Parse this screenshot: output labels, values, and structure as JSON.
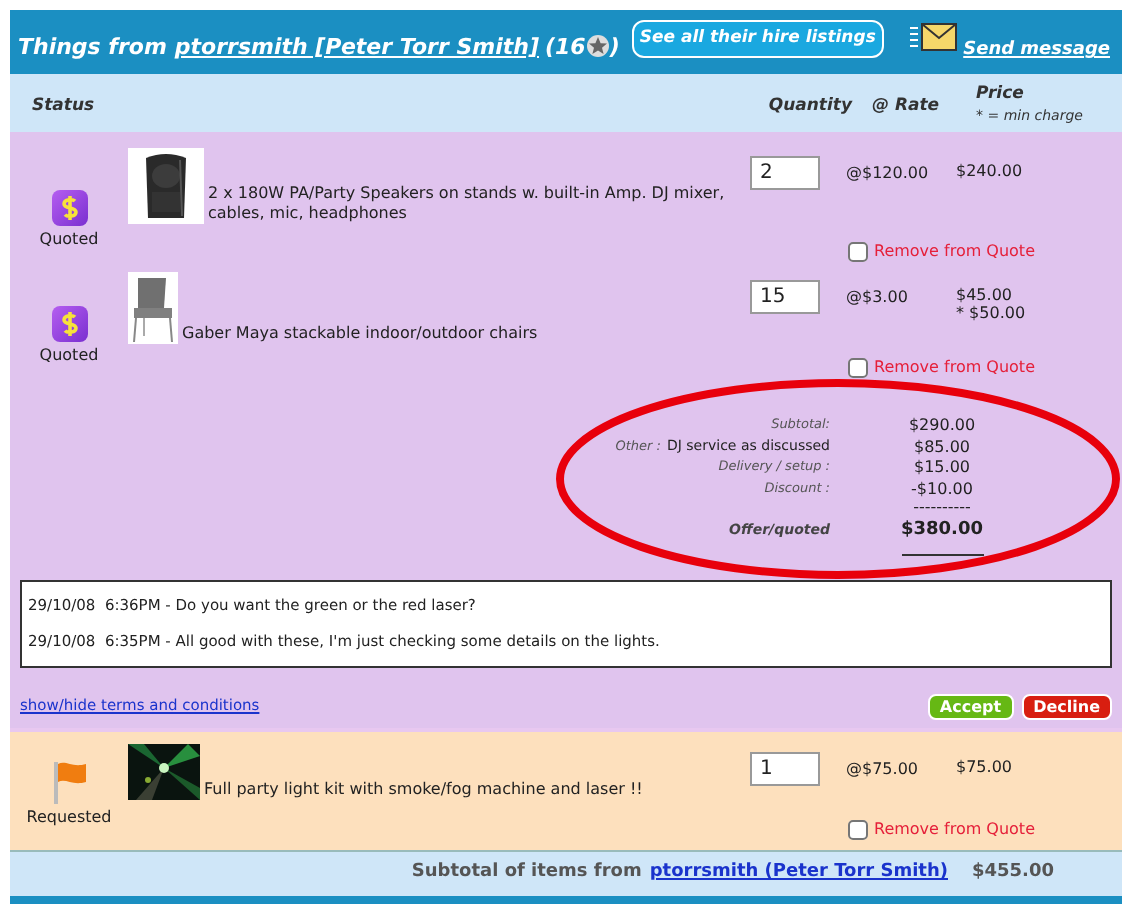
{
  "header": {
    "prefix": "Things from",
    "seller_link": "ptorrsmith [Peter Torr Smith]",
    "rating_open": "(16",
    "rating_close": ")",
    "listings_button": "See all their hire listings",
    "message_link": "Send message"
  },
  "columns": {
    "status": "Status",
    "quantity": "Quantity",
    "rate": "@ Rate",
    "price": "Price",
    "price_note": "* = min charge"
  },
  "quoted_items": [
    {
      "kind": "quoted",
      "status": "Quoted",
      "description": "2 x 180W PA/Party Speakers on stands w. built-in Amp. DJ mixer, cables, mic, headphones",
      "quantity": "2",
      "rate": "@$120.00",
      "price": "$240.00",
      "remove_label": "Remove from Quote",
      "checked": false
    },
    {
      "kind": "quoted",
      "status": "Quoted",
      "description": "Gaber Maya stackable indoor/outdoor chairs",
      "quantity": "15",
      "rate": "@$3.00",
      "price": "$45.00",
      "min_charge": "* $50.00",
      "remove_label": "Remove from Quote",
      "checked": false
    }
  ],
  "summary": {
    "subtotal_label": "Subtotal:",
    "subtotal": "$290.00",
    "other_label": "Other :",
    "other_desc": "DJ service as discussed",
    "other": "$85.00",
    "delivery_label": "Delivery / setup :",
    "delivery": "$15.00",
    "discount_label": "Discount :",
    "discount": "-$10.00",
    "rule": "----------",
    "offer_label": "Offer/quoted",
    "offer": "$380.00"
  },
  "messages": [
    {
      "date": "29/10/08",
      "time": "6:36PM",
      "text": "- Do you want the green or the red laser?"
    },
    {
      "date": "29/10/08",
      "time": "6:35PM",
      "text": "- All good with these, I'm just checking some details on the lights."
    }
  ],
  "terms_link": "show/hide terms and conditions",
  "accept_button": "Accept",
  "decline_button": "Decline",
  "requested_items": [
    {
      "kind": "requested",
      "status": "Requested",
      "description": "Full party light kit with smoke/fog machine and laser !!",
      "quantity": "1",
      "rate": "@$75.00",
      "price": "$75.00",
      "remove_label": "Remove from Quote",
      "checked": false
    }
  ],
  "footer": {
    "label": "Subtotal of items from",
    "seller_link": "ptorrsmith (Peter Torr Smith)",
    "total": "$455.00"
  }
}
